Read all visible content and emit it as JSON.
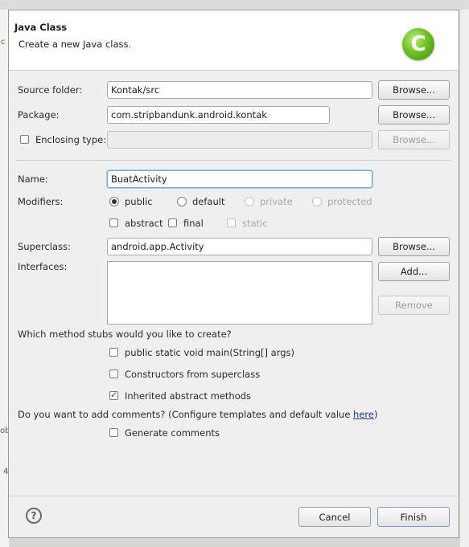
{
  "background": {
    "left_fragment_1": "c",
    "left_fragment_2": "ob",
    "left_fragment_3": "4"
  },
  "header": {
    "title": "Java Class",
    "subtitle": "Create a new Java class.",
    "logo_letter": "C",
    "logo_icon": "java-class-wizard-icon"
  },
  "source_folder": {
    "label": "Source folder:",
    "value": "Kontak/src",
    "browse": "Browse..."
  },
  "package": {
    "label": "Package:",
    "value": "com.stripbandunk.android.kontak",
    "browse": "Browse..."
  },
  "enclosing_type": {
    "label": "Enclosing type:",
    "value": "",
    "browse": "Browse...",
    "checked": false
  },
  "name": {
    "label": "Name:",
    "value": "BuatActivity"
  },
  "modifiers": {
    "label": "Modifiers:",
    "access": [
      "public",
      "default",
      "private",
      "protected"
    ],
    "selected": "public",
    "abstract": "abstract",
    "final": "final",
    "static": "static"
  },
  "superclass": {
    "label": "Superclass:",
    "value": "android.app.Activity",
    "browse": "Browse..."
  },
  "interfaces": {
    "label": "Interfaces:",
    "add": "Add...",
    "remove": "Remove"
  },
  "stubs": {
    "question": "Which method stubs would you like to create?",
    "main": "public static void main(String[] args)",
    "constructors": "Constructors from superclass",
    "inherited": "Inherited abstract methods",
    "main_checked": false,
    "constructors_checked": false,
    "inherited_checked": true
  },
  "comments": {
    "question": "Do you want to add comments? (Configure templates and default value ",
    "link": "here",
    "question_end": ")",
    "generate": "Generate comments",
    "generate_checked": false
  },
  "footer": {
    "help": "?",
    "cancel": "Cancel",
    "finish": "Finish"
  },
  "colors": {
    "accent": "#7d9cc4",
    "logo_green": "#6fc126"
  }
}
